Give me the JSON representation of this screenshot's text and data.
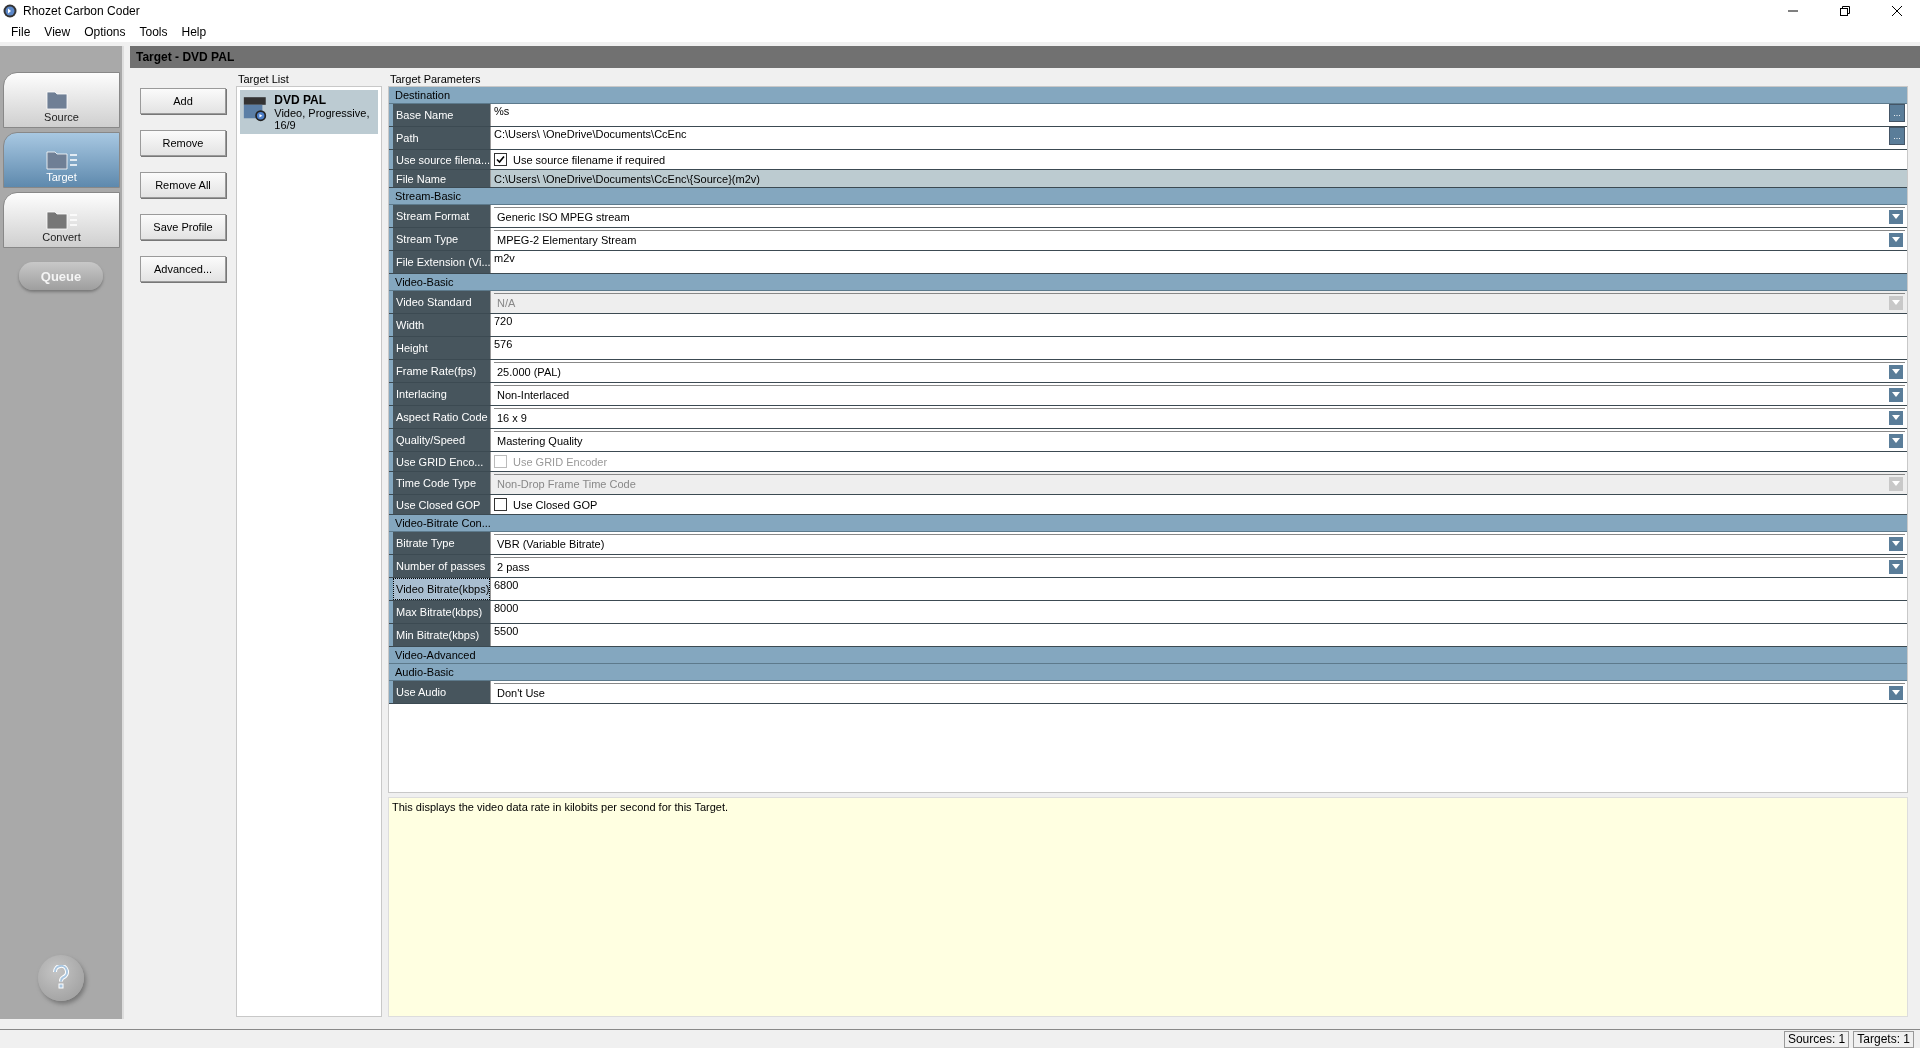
{
  "window": {
    "title": "Rhozet Carbon Coder"
  },
  "menu": [
    "File",
    "View",
    "Options",
    "Tools",
    "Help"
  ],
  "nav": [
    {
      "label": "Source",
      "selected": false
    },
    {
      "label": "Target",
      "selected": true
    },
    {
      "label": "Convert",
      "selected": false
    }
  ],
  "queue_button": "Queue",
  "header": "Target - DVD PAL",
  "buttons": [
    "Add",
    "Remove",
    "Remove All",
    "Save Profile",
    "Advanced..."
  ],
  "target_list": {
    "title": "Target List",
    "items": [
      {
        "name": "DVD PAL",
        "details": "Video, Progressive, 16/9",
        "selected": true
      }
    ]
  },
  "parameters": {
    "title": "Target Parameters",
    "sections": [
      {
        "title": "Destination",
        "rows": [
          {
            "kind": "text",
            "label": "Base Name",
            "value": "%s",
            "button": "...",
            "selected": false
          },
          {
            "kind": "text",
            "label": "Path",
            "value": "C:\\Users\\ \\OneDrive\\Documents\\CcEnc",
            "button": "...",
            "selected": false
          },
          {
            "kind": "checkbox",
            "label": "Use source filena...",
            "value": "Use source filename if required",
            "checked": true,
            "disabled": false,
            "selected": false
          },
          {
            "kind": "readonly",
            "label": "File Name",
            "value": "C:\\Users\\ \\OneDrive\\Documents\\CcEnc\\{Source}(m2v)",
            "selected": false
          }
        ]
      },
      {
        "title": "Stream-Basic",
        "rows": [
          {
            "kind": "dropdown",
            "label": "Stream Format",
            "value": "Generic ISO MPEG stream",
            "disabled": false,
            "selected": false
          },
          {
            "kind": "dropdown",
            "label": "Stream Type",
            "value": "MPEG-2 Elementary Stream",
            "disabled": false,
            "selected": false
          },
          {
            "kind": "text",
            "label": "File Extension (Vi...",
            "value": "m2v",
            "selected": false
          }
        ]
      },
      {
        "title": "Video-Basic",
        "rows": [
          {
            "kind": "dropdown",
            "label": "Video Standard",
            "value": "N/A",
            "disabled": true,
            "selected": false
          },
          {
            "kind": "text",
            "label": "Width",
            "value": "720",
            "selected": false
          },
          {
            "kind": "text",
            "label": "Height",
            "value": "576",
            "selected": false
          },
          {
            "kind": "dropdown",
            "label": "Frame Rate(fps)",
            "value": "25.000 (PAL)",
            "disabled": false,
            "selected": false
          },
          {
            "kind": "dropdown",
            "label": "Interlacing",
            "value": "Non-Interlaced",
            "disabled": false,
            "selected": false
          },
          {
            "kind": "dropdown",
            "label": "Aspect Ratio Code",
            "value": "16 x 9",
            "disabled": false,
            "selected": false
          },
          {
            "kind": "dropdown",
            "label": "Quality/Speed",
            "value": "Mastering Quality",
            "disabled": false,
            "selected": false
          },
          {
            "kind": "checkbox",
            "label": "Use GRID Enco...",
            "value": "Use GRID Encoder",
            "checked": false,
            "disabled": true,
            "selected": false
          },
          {
            "kind": "dropdown",
            "label": "Time Code Type",
            "value": "Non-Drop Frame Time Code",
            "disabled": true,
            "selected": false
          },
          {
            "kind": "checkbox",
            "label": "Use Closed GOP",
            "value": "Use Closed GOP",
            "checked": false,
            "disabled": false,
            "selected": false
          }
        ]
      },
      {
        "title": "Video-Bitrate Con...",
        "rows": [
          {
            "kind": "dropdown",
            "label": "Bitrate Type",
            "value": "VBR (Variable Bitrate)",
            "disabled": false,
            "selected": false
          },
          {
            "kind": "dropdown",
            "label": "Number of passes",
            "value": "2 pass",
            "disabled": false,
            "selected": false
          },
          {
            "kind": "text",
            "label": "Video Bitrate(kbps)",
            "value": "6800",
            "selected": true
          },
          {
            "kind": "text",
            "label": "Max Bitrate(kbps)",
            "value": "8000",
            "selected": false
          },
          {
            "kind": "text",
            "label": "Min Bitrate(kbps)",
            "value": "5500",
            "selected": false
          }
        ]
      },
      {
        "title": "Video-Advanced"
      },
      {
        "title": "Audio-Basic",
        "rows": [
          {
            "kind": "dropdown",
            "label": "Use Audio",
            "value": "Don't Use",
            "disabled": false,
            "selected": false
          }
        ]
      }
    ]
  },
  "description": "This displays the video data rate in kilobits per second for this Target.",
  "status_bar": [
    "Sources: 1",
    "Targets: 1"
  ]
}
